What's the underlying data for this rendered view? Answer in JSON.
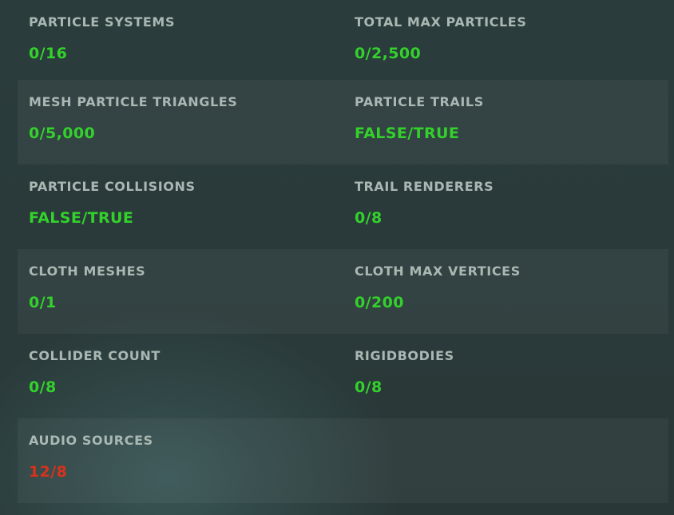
{
  "stats": {
    "rows": [
      [
        {
          "label": "PARTICLE SYSTEMS",
          "value": "0/16",
          "status": "ok"
        },
        {
          "label": "TOTAL MAX PARTICLES",
          "value": "0/2,500",
          "status": "ok"
        }
      ],
      [
        {
          "label": "MESH PARTICLE TRIANGLES",
          "value": "0/5,000",
          "status": "ok"
        },
        {
          "label": "PARTICLE TRAILS",
          "value": "FALSE/TRUE",
          "status": "ok"
        }
      ],
      [
        {
          "label": "PARTICLE COLLISIONS",
          "value": "FALSE/TRUE",
          "status": "ok"
        },
        {
          "label": "TRAIL RENDERERS",
          "value": "0/8",
          "status": "ok"
        }
      ],
      [
        {
          "label": "CLOTH MESHES",
          "value": "0/1",
          "status": "ok"
        },
        {
          "label": "CLOTH MAX VERTICES",
          "value": "0/200",
          "status": "ok"
        }
      ],
      [
        {
          "label": "COLLIDER COUNT",
          "value": "0/8",
          "status": "ok"
        },
        {
          "label": "RIGIDBODIES",
          "value": "0/8",
          "status": "ok"
        }
      ],
      [
        {
          "label": "AUDIO SOURCES",
          "value": "12/8",
          "status": "over"
        }
      ]
    ]
  },
  "colors": {
    "ok": "#33d12c",
    "over": "#d8321c",
    "label": "#a9b8b2"
  }
}
